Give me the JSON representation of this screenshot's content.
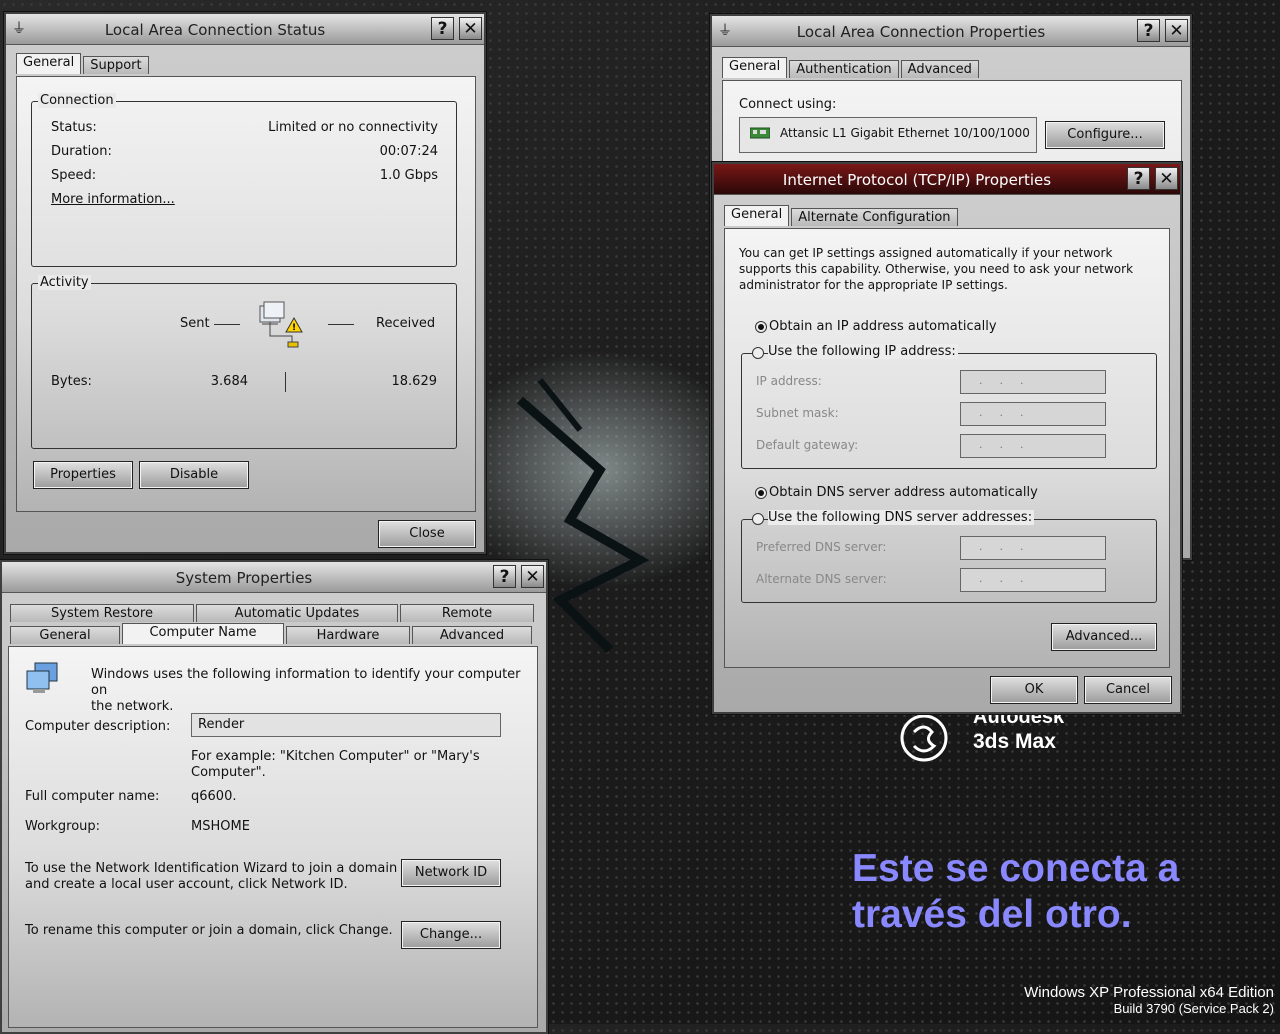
{
  "status_window": {
    "title": "Local Area Connection Status",
    "tabs": [
      "General",
      "Support"
    ],
    "connection": {
      "group_label": "Connection",
      "status_label": "Status:",
      "status_value": "Limited or no connectivity",
      "duration_label": "Duration:",
      "duration_value": "00:07:24",
      "speed_label": "Speed:",
      "speed_value": "1.0 Gbps",
      "more_info": "More information..."
    },
    "activity": {
      "group_label": "Activity",
      "sent": "Sent",
      "received": "Received",
      "bytes_label": "Bytes:",
      "bytes_sent": "3.684",
      "bytes_received": "18.629"
    },
    "properties_button": "Properties",
    "disable_button": "Disable",
    "close_button": "Close"
  },
  "props_window": {
    "title": "Local Area Connection Properties",
    "tabs": [
      "General",
      "Authentication",
      "Advanced"
    ],
    "connect_using_label": "Connect using:",
    "adapter_name": "Attansic L1 Gigabit Ethernet 10/100/1000",
    "configure_button": "Configure..."
  },
  "tcpip_window": {
    "title": "Internet Protocol (TCP/IP) Properties",
    "tabs": [
      "General",
      "Alternate Configuration"
    ],
    "description": [
      "You can get IP settings assigned automatically if your network",
      "supports this capability. Otherwise, you need to ask your network",
      "administrator for the appropriate IP settings."
    ],
    "obtain_ip_auto": "Obtain an IP address automatically",
    "use_following_ip": "Use the following IP address:",
    "ip_address_label": "IP address:",
    "subnet_label": "Subnet mask:",
    "gateway_label": "Default gateway:",
    "obtain_dns_auto": "Obtain DNS server address automatically",
    "use_following_dns": "Use the following DNS server addresses:",
    "preferred_dns_label": "Preferred DNS server:",
    "alternate_dns_label": "Alternate DNS server:",
    "ip_auto_selected": true,
    "dns_auto_selected": true,
    "advanced_button": "Advanced...",
    "ok_button": "OK",
    "cancel_button": "Cancel"
  },
  "system_window": {
    "title": "System Properties",
    "tabs_row1": [
      "System Restore",
      "Automatic Updates",
      "Remote"
    ],
    "tabs_row2": [
      "General",
      "Computer Name",
      "Hardware",
      "Advanced"
    ],
    "intro": [
      "Windows uses the following information to identify your computer on",
      "the network."
    ],
    "desc_label": "Computer description:",
    "desc_value": "Render",
    "example": [
      "For example: \"Kitchen Computer\" or \"Mary's",
      "Computer\"."
    ],
    "full_name_label": "Full computer name:",
    "full_name_value": "q6600.",
    "workgroup_label": "Workgroup:",
    "workgroup_value": "MSHOME",
    "network_id_text": [
      "To use the Network Identification Wizard to join a domain",
      "and create a local user account, click Network ID."
    ],
    "network_id_button": "Network ID",
    "rename_text": "To rename this computer or join a domain, click Change.",
    "change_button": "Change..."
  },
  "desktop": {
    "logo_line1": "Autodesk",
    "logo_line2": "3ds Max",
    "caption_line1": "Este se conecta a",
    "caption_line2": "través del otro.",
    "caption_color": "#8a88ff",
    "os_line1": "Windows XP Professional x64 Edition",
    "os_line2": "Build 3790 (Service Pack 2)"
  }
}
